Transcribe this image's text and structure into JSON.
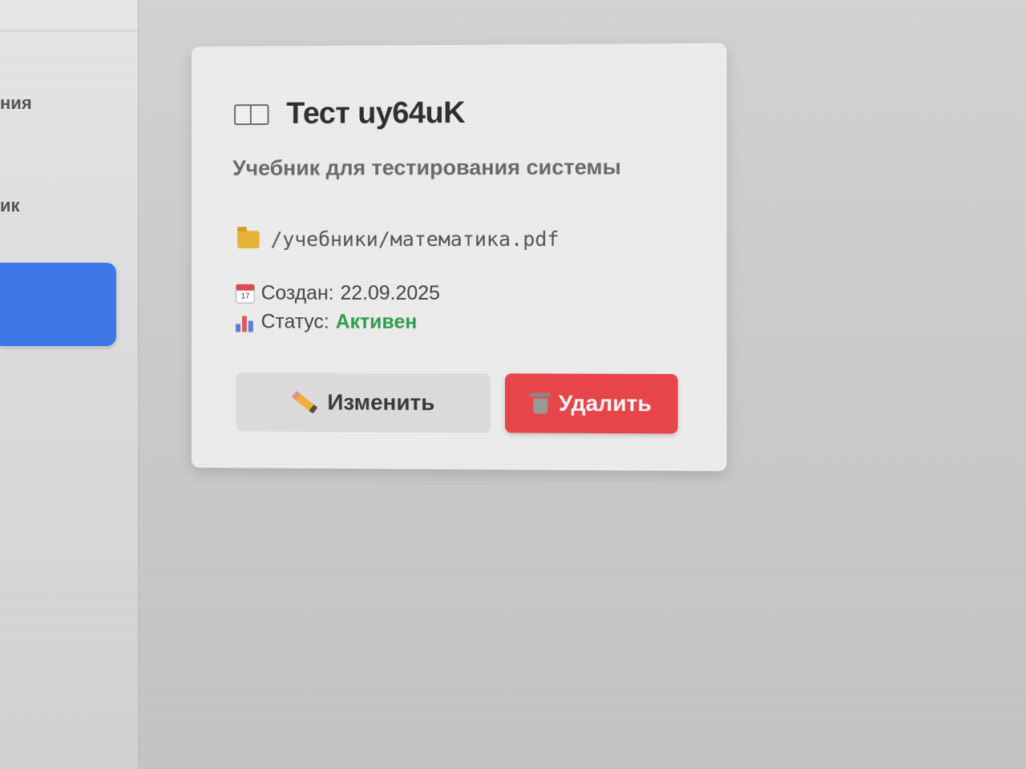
{
  "sidebar": {
    "items": [
      {
        "label": "ния"
      },
      {
        "label": "ик"
      }
    ]
  },
  "card": {
    "title": "Тест uy64uK",
    "description": "Учебник для тестирования системы",
    "path": "/учебники/математика.pdf",
    "calendar_day": "17",
    "created_label": "Создан:",
    "created_value": "22.09.2025",
    "status_label": "Статус:",
    "status_value": "Активен",
    "status_color": "#2e9d4f",
    "edit_label": "Изменить",
    "delete_label": "Удалить",
    "delete_color": "#e8464a",
    "active_nav_color": "#3d78e8",
    "icons": {
      "title": "book-icon",
      "path": "folder-icon",
      "created": "calendar-icon",
      "status": "bar-chart-icon",
      "edit": "pencil-icon",
      "delete": "trash-icon"
    }
  }
}
